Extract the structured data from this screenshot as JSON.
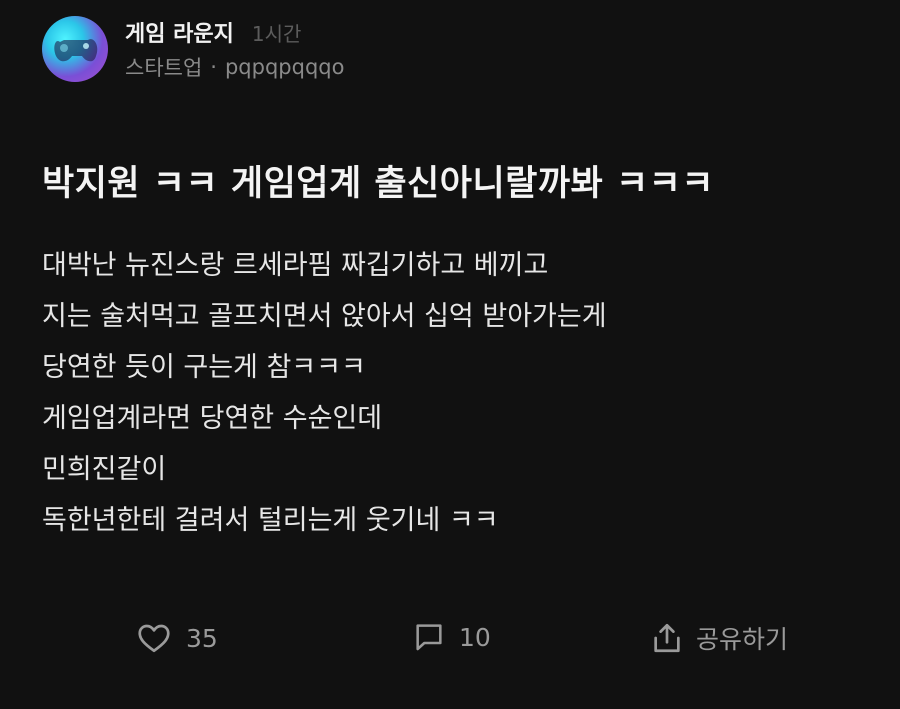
{
  "header": {
    "group_name": "게임 라운지",
    "time_ago": "1시간",
    "category": "스타트업",
    "separator": "·",
    "username": "pqpqpqqqo"
  },
  "post": {
    "title": "박지원 ㅋㅋ 게임업계 출신아니랄까봐 ㅋㅋㅋ",
    "body_lines": [
      "대박난 뉴진스랑 르세라핌 짜깁기하고 베끼고",
      "지는 술처먹고 골프치면서 앉아서 십억 받아가는게",
      "당연한 듯이 구는게 참ㅋㅋㅋ",
      "게임업계라면 당연한 수순인데",
      "민희진같이",
      "독한년한테 걸려서 털리는게 웃기네 ㅋㅋ"
    ]
  },
  "actions": {
    "like_icon": "heart-icon",
    "like_count": "35",
    "comment_icon": "comment-icon",
    "comment_count": "10",
    "share_icon": "share-icon",
    "share_label": "공유하기"
  },
  "colors": {
    "background": "#111111",
    "text_primary": "#f4f4f4",
    "text_secondary": "#8a8a8a",
    "text_muted": "#5c5c5c"
  }
}
